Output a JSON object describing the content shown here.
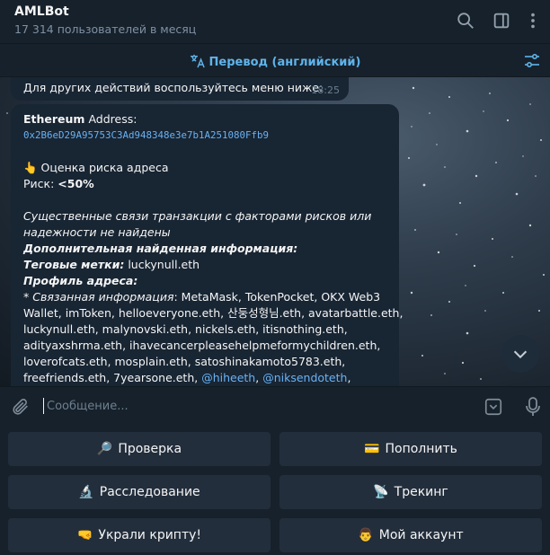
{
  "header": {
    "title": "AMLBot",
    "subtitle": "17 314 пользователей в месяц"
  },
  "translate_bar": {
    "label": "Перевод (английский)"
  },
  "previous_message": {
    "text": "Для других действий воспользуйтесь меню ниже:",
    "time": "18:25"
  },
  "message": {
    "network": "Ethereum",
    "address_label": " Address:",
    "address": "0x2B6eD29A95753C3Ad948348e3e7b1A251080Ffb9",
    "risk_emoji": "👆",
    "risk_heading": " Оценка риска адреса",
    "risk_label": "Риск: ",
    "risk_value": "<50%",
    "no_links_1": "Существенные связи транзакции с факторами рисков или",
    "no_links_2": "надежности не найдены",
    "extra_info": "Дополнительная найденная информация:",
    "tags_label": "Теговые метки:",
    "tags_value": " luckynull.eth",
    "profile_label": "Профиль адреса:",
    "related_prefix": "* ",
    "related_label": "Связанная информация",
    "related_line1": ": MetaMask, TokenPocket, OKX Web3",
    "related_line2": "Wallet, imToken, helloeveryone.eth, 산둥성형님.eth, avatarbattle.eth,",
    "related_line3": "luckynull.eth, malynovski.eth, nickels.eth, itisnothing.eth,",
    "related_line4": "adityaxshrma.eth, ihavecancerpleasehelpmeformychildren.eth,",
    "related_line5": "loverofcats.eth, mosplain.eth, satoshinakamoto5783.eth,",
    "related_line6": "freefriends.eth, 7yearsone.eth, ",
    "mention1": "@hiheeth",
    "sep": ", ",
    "mention2": "@niksendoteth",
    "tail": ","
  },
  "composer": {
    "placeholder": "Сообщение..."
  },
  "keyboard": {
    "buttons": [
      {
        "emoji": "🔎",
        "label": "Проверка"
      },
      {
        "emoji": "💳",
        "label": "Пополнить"
      },
      {
        "emoji": "🔬",
        "label": "Расследование"
      },
      {
        "emoji": "📡",
        "label": "Трекинг"
      },
      {
        "emoji": "🤜",
        "label": "Украли крипту!"
      },
      {
        "emoji": "👨",
        "label": "Мой аккаунт"
      }
    ]
  },
  "colors": {
    "accent": "#5fb4ea",
    "link": "#6ab2f2",
    "bubble": "#182533",
    "panel": "#17212b",
    "button": "#232e3c"
  },
  "icons": [
    "search-icon",
    "sidebar-icon",
    "more-icon",
    "translate-icon",
    "filter-icon",
    "chevron-down-icon",
    "paperclip-icon",
    "keyboard-icon",
    "microphone-icon"
  ]
}
